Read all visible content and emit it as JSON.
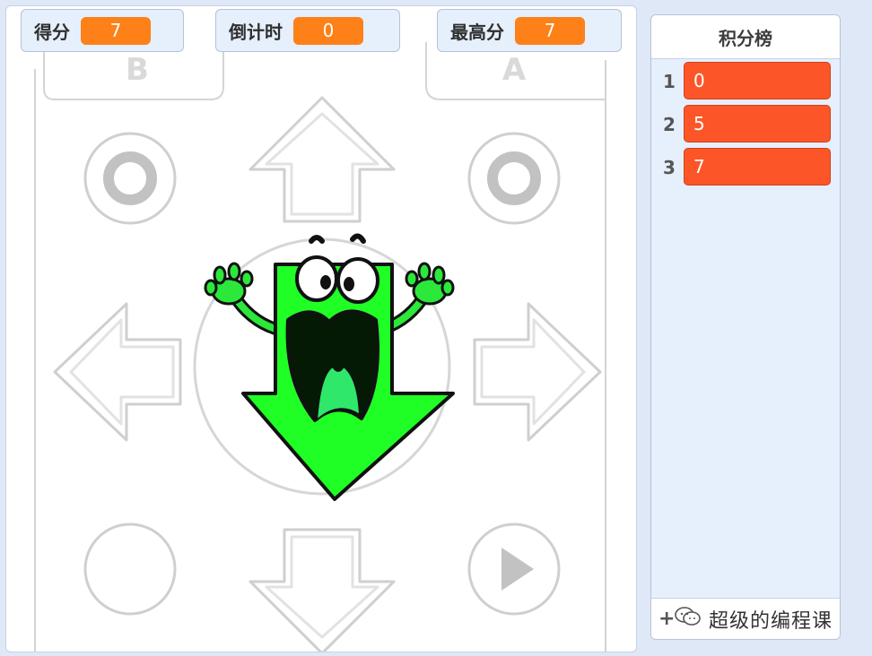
{
  "monitors": {
    "score": {
      "label": "得分",
      "value": "7"
    },
    "timer": {
      "label": "倒计时",
      "value": "0"
    },
    "high": {
      "label": "最高分",
      "value": "7"
    }
  },
  "leaderboard": {
    "title": "积分榜",
    "items": [
      {
        "index": "1",
        "value": "0"
      },
      {
        "index": "2",
        "value": "5"
      },
      {
        "index": "3",
        "value": "7"
      }
    ],
    "add_symbol": "+"
  },
  "stage": {
    "bg_letter_left": "B",
    "bg_letter_right": "A"
  },
  "watermark": {
    "text": "超级的编程课",
    "icon": "wechat-icon"
  },
  "colors": {
    "monitor_value": "#fd8018",
    "list_item": "#fc5628",
    "character": "#22ee22"
  }
}
